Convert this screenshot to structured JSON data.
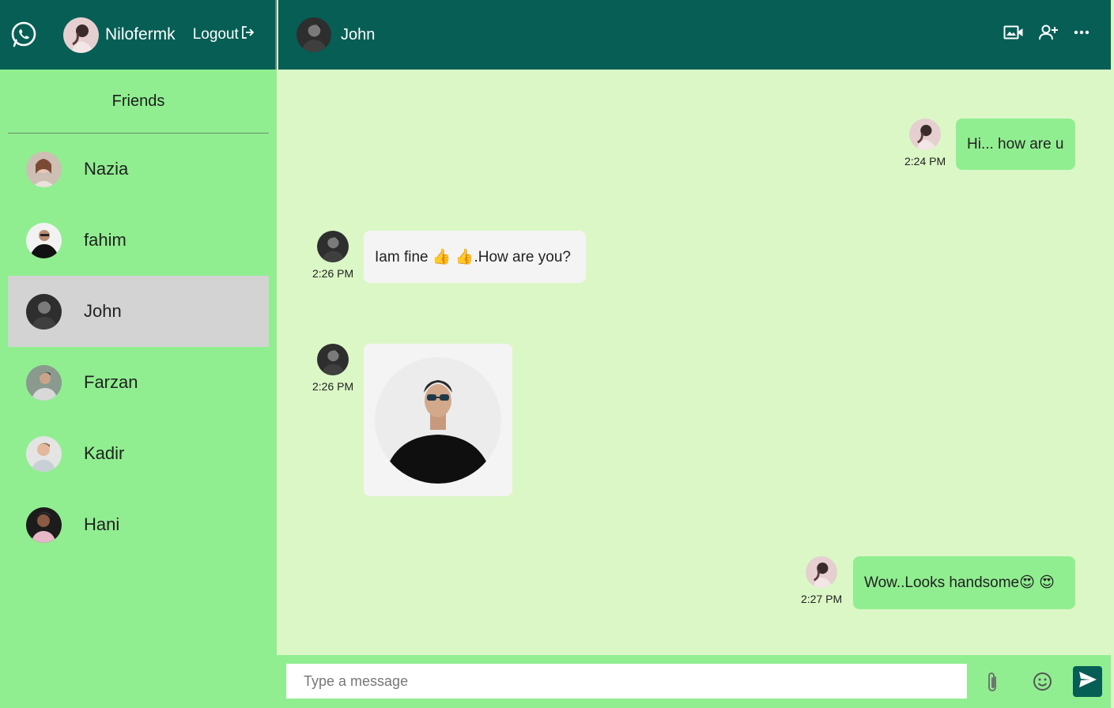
{
  "user": {
    "name": "Nilofermk",
    "logout_label": "Logout"
  },
  "sidebar": {
    "title": "Friends",
    "friends": [
      {
        "name": "Nazia"
      },
      {
        "name": "fahim"
      },
      {
        "name": "John"
      },
      {
        "name": "Farzan"
      },
      {
        "name": "Kadir"
      },
      {
        "name": "Hani"
      }
    ]
  },
  "chat": {
    "contact_name": "John",
    "messages": [
      {
        "text": "Hi... how are u",
        "time": "2:24 PM"
      },
      {
        "text": "Iam fine 👍 👍.How are you?",
        "time": "2:26 PM"
      },
      {
        "text": "",
        "time": "2:26 PM"
      },
      {
        "text": "Wow..Looks handsome😍 😍",
        "time": "2:27 PM"
      }
    ]
  },
  "composer": {
    "placeholder": "Type a message"
  },
  "colors": {
    "header": "#065e55",
    "sidebar": "#90ee90",
    "chat_bg": "#dbf7c6",
    "my_bubble": "#90ee90",
    "their_bubble": "#f4f4f4",
    "active_friend": "#d3d3d3"
  },
  "icons": [
    "whatsapp-icon",
    "logout-icon",
    "video-call-icon",
    "add-user-icon",
    "more-icon",
    "attach-icon",
    "emoji-icon",
    "send-icon"
  ]
}
